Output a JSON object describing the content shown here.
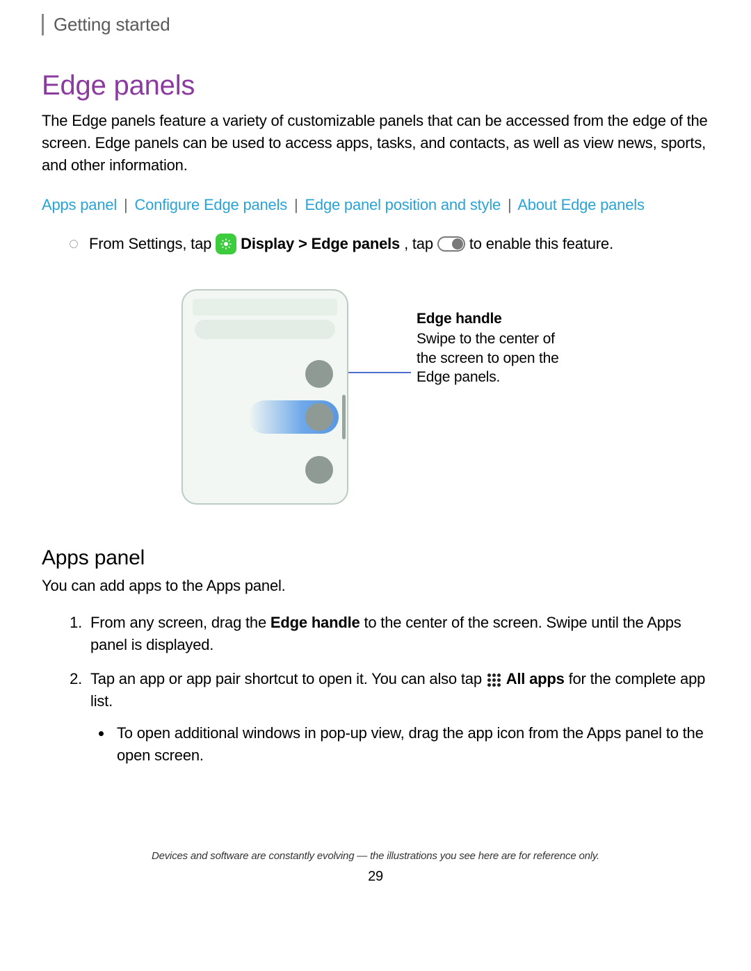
{
  "breadcrumb": "Getting started",
  "title": "Edge panels",
  "intro": "The Edge panels feature a variety of customizable panels that can be accessed from the edge of the screen. Edge panels can be used to access apps, tasks, and contacts, as well as view news, sports, and other information.",
  "links": {
    "l1": "Apps panel",
    "l2": "Configure Edge panels",
    "l3": "Edge panel position and style",
    "l4": "About Edge panels",
    "sep": "|"
  },
  "instruction": {
    "pre": "From Settings, tap",
    "display": "Display",
    "arrow": ">",
    "edge": "Edge panels",
    "mid": ", tap",
    "post": "to enable this feature."
  },
  "diagram": {
    "caption_title": "Edge handle",
    "caption_body": "Swipe to the center of the screen to open the Edge panels."
  },
  "apps_panel": {
    "heading": "Apps panel",
    "intro": "You can add apps to the Apps panel.",
    "step1_a": "From any screen, drag the ",
    "step1_bold": "Edge handle",
    "step1_b": " to the center of the screen. Swipe until the Apps panel is displayed.",
    "step2_a": "Tap an app or app pair shortcut to open it. You can also tap",
    "step2_bold": "All apps",
    "step2_b": " for the complete app list.",
    "step2_bullet": "To open additional windows in pop-up view, drag the app icon from the Apps panel to the open screen."
  },
  "footer": "Devices and software are constantly evolving — the illustrations you see here are for reference only.",
  "page_number": "29"
}
